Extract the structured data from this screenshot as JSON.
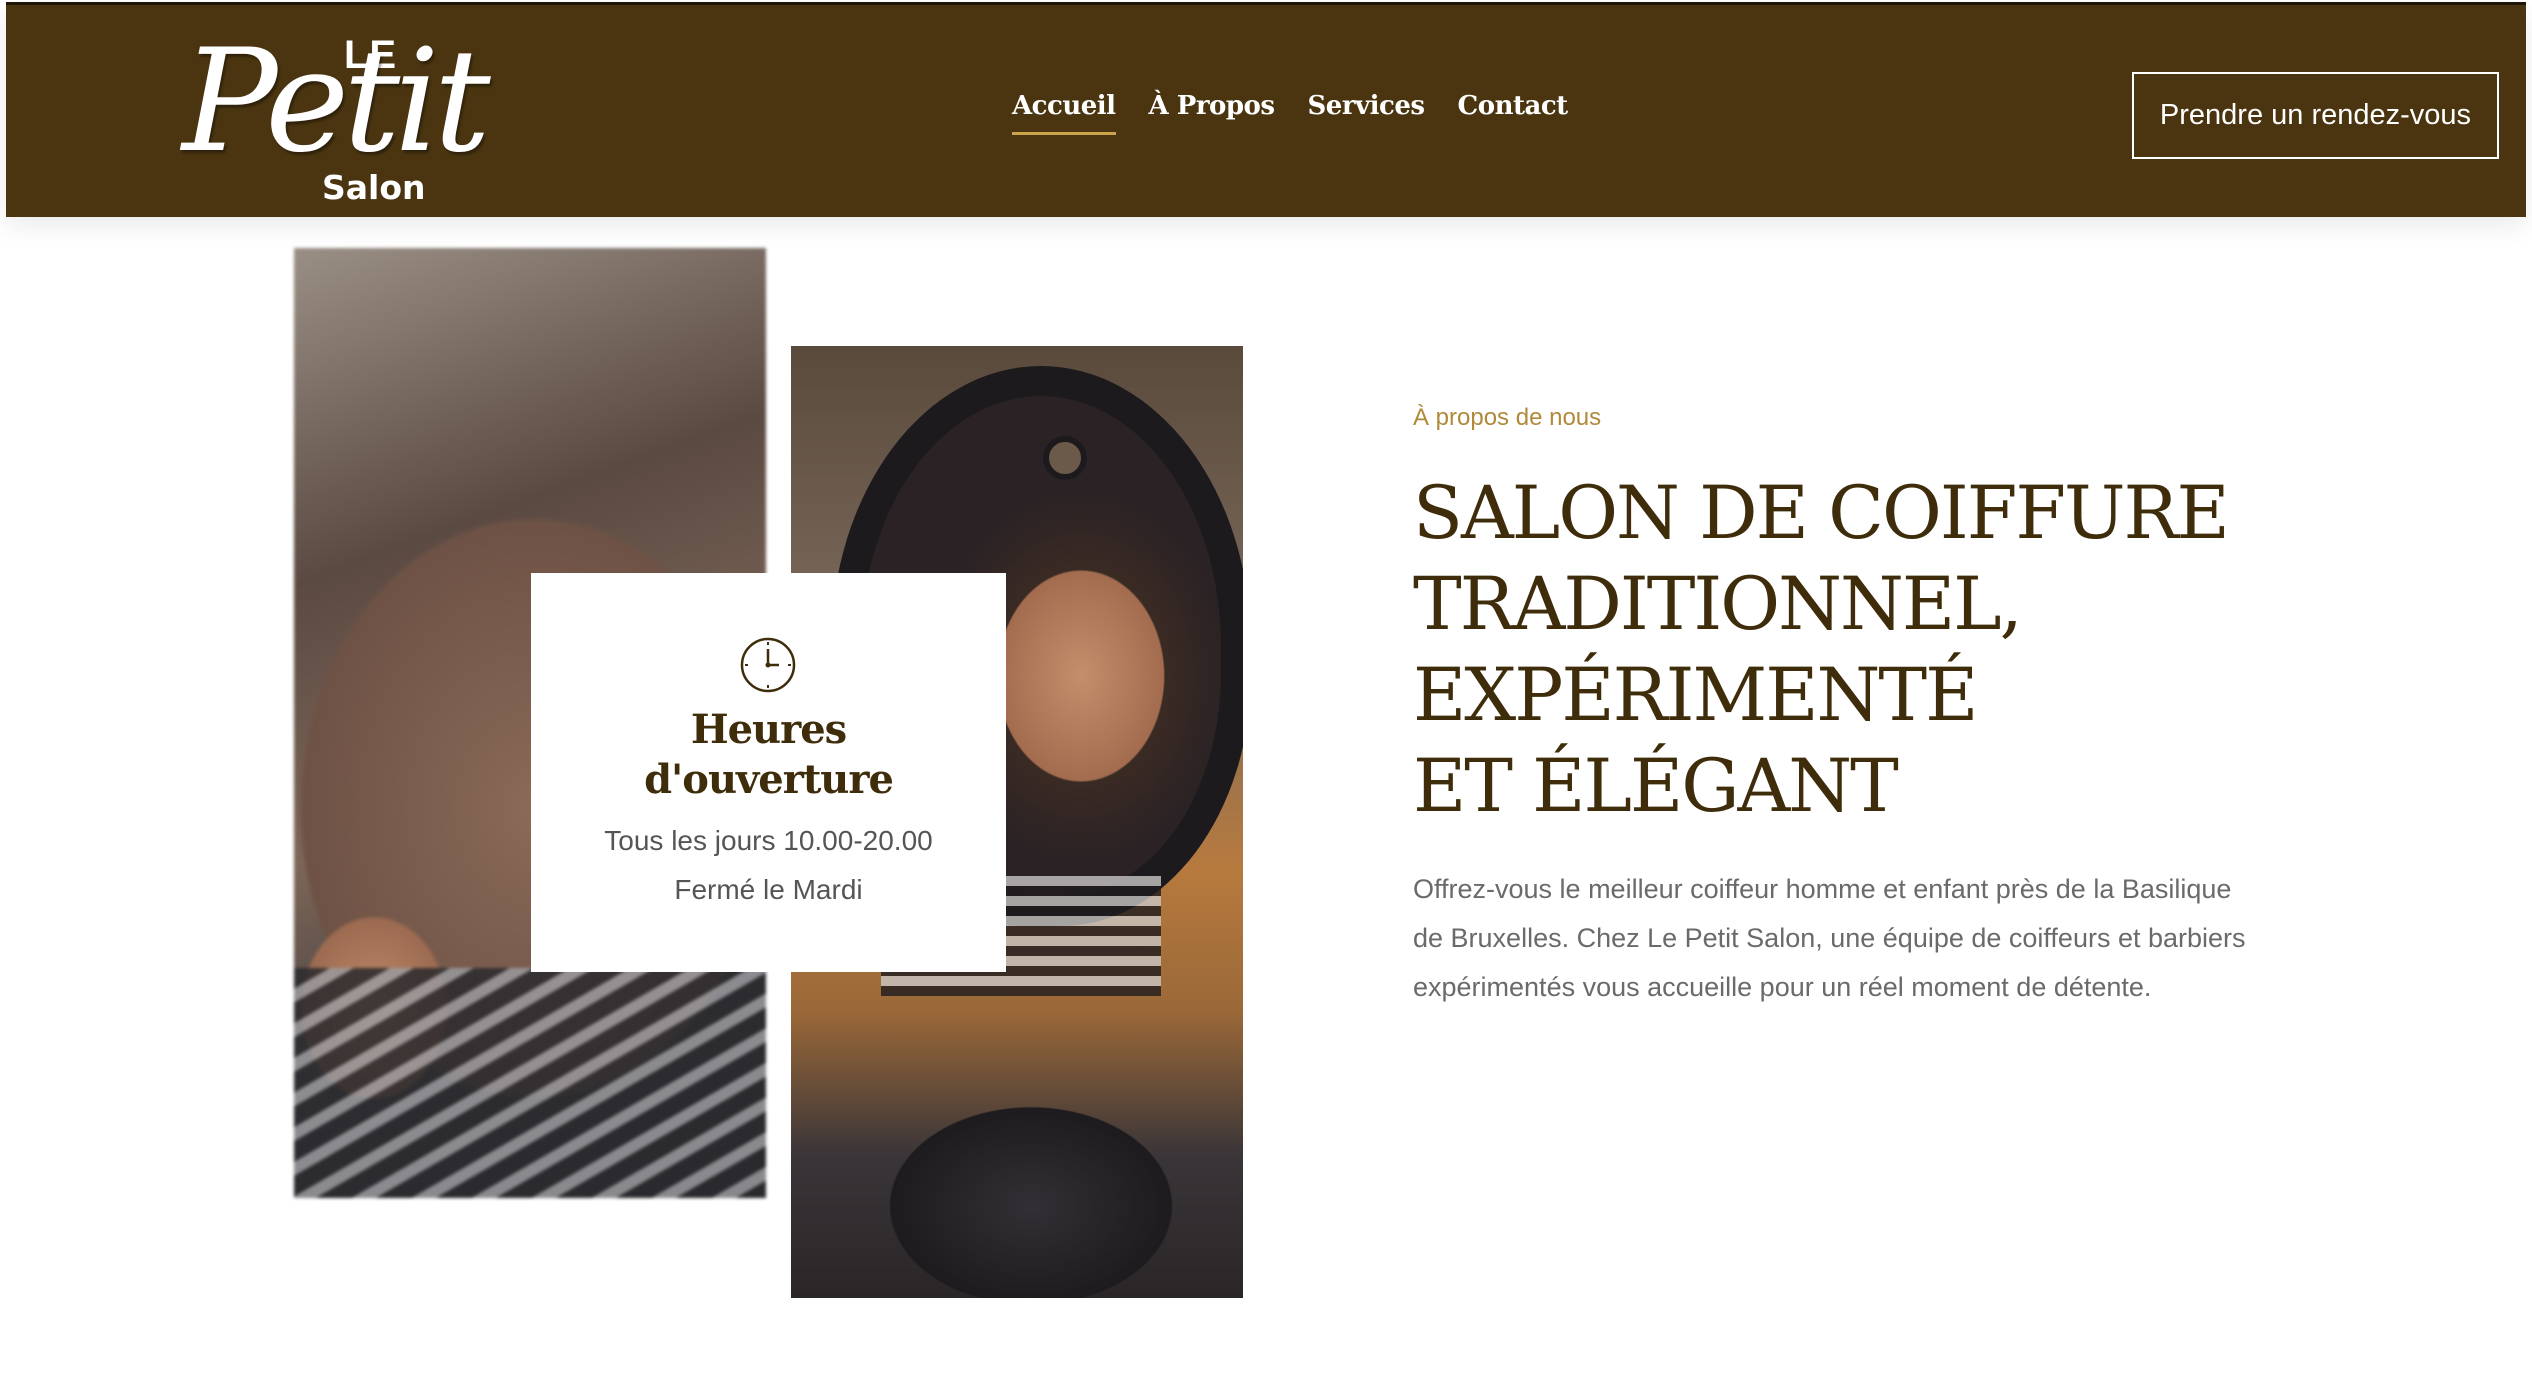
{
  "header": {
    "logo": {
      "top": "LE",
      "main": "Petit",
      "bottom": "Salon"
    },
    "nav": [
      {
        "label": "Accueil",
        "active": true
      },
      {
        "label": "À Propos",
        "active": false
      },
      {
        "label": "Services",
        "active": false
      },
      {
        "label": "Contact",
        "active": false
      }
    ],
    "cta_label": "Prendre un rendez-vous"
  },
  "hours_card": {
    "icon": "clock-icon",
    "title_line1": "Heures",
    "title_line2": "d'ouverture",
    "schedule": "Tous les jours 10.00-20.00",
    "closed": "Fermé le Mardi"
  },
  "about": {
    "eyebrow": "À propos de nous",
    "headline": [
      "SALON DE COIFFURE",
      "TRADITIONNEL,",
      "EXPÉRIMENTÉ",
      "ET ÉLÉGANT"
    ],
    "description": "Offrez-vous le meilleur coiffeur homme et enfant près de la Basilique de Bruxelles. Chez Le Petit Salon, une équipe de coiffeurs et barbiers expérimentés vous accueille pour un réel moment de détente."
  },
  "colors": {
    "header_bg": "#4a3510",
    "accent": "#c9a44b",
    "heading": "#3e2c0a",
    "eyebrow": "#b08a3a",
    "body_text": "#6a6a6a"
  }
}
